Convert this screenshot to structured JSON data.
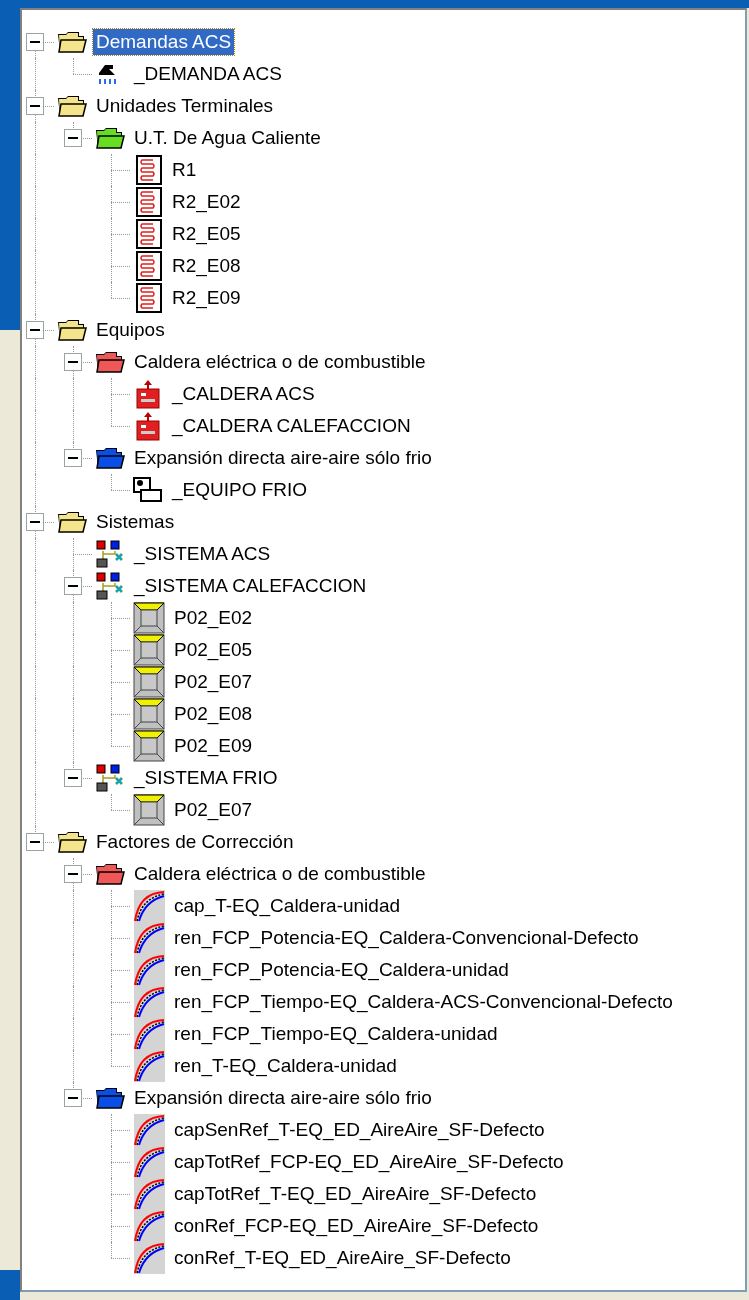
{
  "tree": [
    {
      "label": "Demandas ACS",
      "kind": "folder",
      "color": "#f4e48a",
      "selected": true,
      "expanded": true,
      "children": [
        {
          "label": "_DEMANDA ACS",
          "kind": "shower",
          "selected": false
        }
      ]
    },
    {
      "label": "Unidades Terminales",
      "kind": "folder",
      "color": "#f4e48a",
      "selected": false,
      "expanded": true,
      "children": [
        {
          "label": "U.T. De Agua Caliente",
          "kind": "folder",
          "color": "#66dd22",
          "selected": false,
          "expanded": true,
          "children": [
            {
              "label": "R1",
              "kind": "radiator",
              "selected": false
            },
            {
              "label": "R2_E02",
              "kind": "radiator",
              "selected": false
            },
            {
              "label": "R2_E05",
              "kind": "radiator",
              "selected": false
            },
            {
              "label": "R2_E08",
              "kind": "radiator",
              "selected": false
            },
            {
              "label": "R2_E09",
              "kind": "radiator",
              "selected": false
            }
          ]
        }
      ]
    },
    {
      "label": "Equipos",
      "kind": "folder",
      "color": "#f4e48a",
      "selected": false,
      "expanded": true,
      "children": [
        {
          "label": "Caldera eléctrica o de combustible",
          "kind": "folder",
          "color": "#f05858",
          "selected": false,
          "expanded": true,
          "children": [
            {
              "label": "_CALDERA ACS",
              "kind": "boiler",
              "selected": false
            },
            {
              "label": "_CALDERA CALEFACCION",
              "kind": "boiler",
              "selected": false
            }
          ]
        },
        {
          "label": "Expansión directa aire-aire sólo frio",
          "kind": "folder",
          "color": "#0a4ee8",
          "selected": false,
          "expanded": true,
          "children": [
            {
              "label": "_EQUIPO FRIO",
              "kind": "unit",
              "selected": false
            }
          ]
        }
      ]
    },
    {
      "label": "Sistemas",
      "kind": "folder",
      "color": "#f4e48a",
      "selected": false,
      "expanded": true,
      "children": [
        {
          "label": "_SISTEMA ACS",
          "kind": "system",
          "selected": false
        },
        {
          "label": "_SISTEMA CALEFACCION",
          "kind": "system",
          "selected": false,
          "expanded": true,
          "children": [
            {
              "label": "P02_E02",
              "kind": "terminal",
              "selected": false
            },
            {
              "label": "P02_E05",
              "kind": "terminal",
              "selected": false
            },
            {
              "label": "P02_E07",
              "kind": "terminal",
              "selected": false
            },
            {
              "label": "P02_E08",
              "kind": "terminal",
              "selected": false
            },
            {
              "label": "P02_E09",
              "kind": "terminal",
              "selected": false
            }
          ]
        },
        {
          "label": "_SISTEMA FRIO",
          "kind": "system",
          "selected": false,
          "expanded": true,
          "children": [
            {
              "label": "P02_E07",
              "kind": "terminal",
              "selected": false
            }
          ]
        }
      ]
    },
    {
      "label": "Factores de Corrección",
      "kind": "folder",
      "color": "#f4e48a",
      "selected": false,
      "expanded": true,
      "children": [
        {
          "label": "Caldera eléctrica o de combustible",
          "kind": "folder",
          "color": "#f05858",
          "selected": false,
          "expanded": true,
          "children": [
            {
              "label": "cap_T-EQ_Caldera-unidad",
              "kind": "curve",
              "selected": false
            },
            {
              "label": "ren_FCP_Potencia-EQ_Caldera-Convencional-Defecto",
              "kind": "curve",
              "selected": false
            },
            {
              "label": "ren_FCP_Potencia-EQ_Caldera-unidad",
              "kind": "curve",
              "selected": false
            },
            {
              "label": "ren_FCP_Tiempo-EQ_Caldera-ACS-Convencional-Defecto",
              "kind": "curve",
              "selected": false
            },
            {
              "label": "ren_FCP_Tiempo-EQ_Caldera-unidad",
              "kind": "curve",
              "selected": false
            },
            {
              "label": "ren_T-EQ_Caldera-unidad",
              "kind": "curve",
              "selected": false
            }
          ]
        },
        {
          "label": "Expansión directa aire-aire sólo frio",
          "kind": "folder",
          "color": "#0a4ee8",
          "selected": false,
          "expanded": true,
          "children": [
            {
              "label": "capSenRef_T-EQ_ED_AireAire_SF-Defecto",
              "kind": "curve",
              "selected": false
            },
            {
              "label": "capTotRef_FCP-EQ_ED_AireAire_SF-Defecto",
              "kind": "curve",
              "selected": false
            },
            {
              "label": "capTotRef_T-EQ_ED_AireAire_SF-Defecto",
              "kind": "curve",
              "selected": false
            },
            {
              "label": "conRef_FCP-EQ_ED_AireAire_SF-Defecto",
              "kind": "curve",
              "selected": false
            },
            {
              "label": "conRef_T-EQ_ED_AireAire_SF-Defecto",
              "kind": "curve",
              "selected": false
            }
          ]
        }
      ]
    }
  ]
}
